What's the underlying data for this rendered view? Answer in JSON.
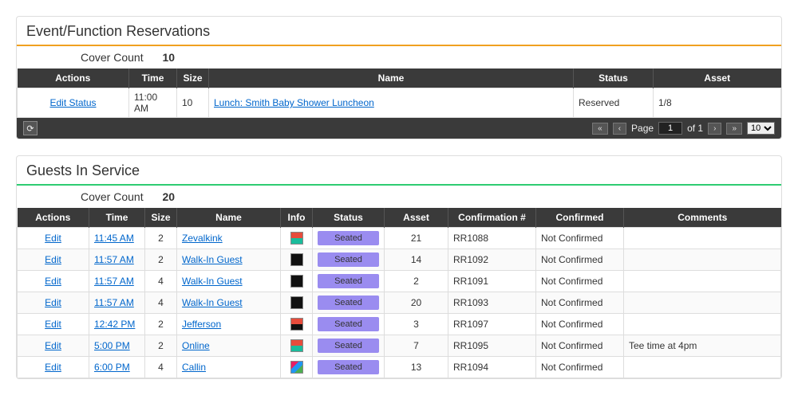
{
  "events": {
    "title": "Event/Function Reservations",
    "cover_label": "Cover Count",
    "cover_value": "10",
    "columns": {
      "actions": "Actions",
      "time": "Time",
      "size": "Size",
      "name": "Name",
      "status": "Status",
      "asset": "Asset"
    },
    "rows": [
      {
        "action_label": "Edit Status",
        "time": "11:00 AM",
        "size": "10",
        "name": "Lunch: Smith Baby Shower Luncheon",
        "status": "Reserved",
        "asset": "1/8"
      }
    ],
    "pager": {
      "page_label_pre": "Page",
      "page_value": "1",
      "page_label_post": "of 1",
      "page_size": "10"
    }
  },
  "guests": {
    "title": "Guests In Service",
    "cover_label": "Cover Count",
    "cover_value": "20",
    "columns": {
      "actions": "Actions",
      "time": "Time",
      "size": "Size",
      "name": "Name",
      "info": "Info",
      "status": "Status",
      "asset": "Asset",
      "confirmation": "Confirmation #",
      "confirmed": "Confirmed",
      "comments": "Comments"
    },
    "rows": [
      {
        "action": "Edit",
        "time": "11:45 AM",
        "size": "2",
        "name": "Zevalkink",
        "info_variant": "a",
        "status": "Seated",
        "asset": "21",
        "confirmation": "RR1088",
        "confirmed": "Not Confirmed",
        "comments": ""
      },
      {
        "action": "Edit",
        "time": "11:57 AM",
        "size": "2",
        "name": "Walk-In Guest",
        "info_variant": "b",
        "status": "Seated",
        "asset": "14",
        "confirmation": "RR1092",
        "confirmed": "Not Confirmed",
        "comments": ""
      },
      {
        "action": "Edit",
        "time": "11:57 AM",
        "size": "4",
        "name": "Walk-In Guest",
        "info_variant": "b",
        "status": "Seated",
        "asset": "2",
        "confirmation": "RR1091",
        "confirmed": "Not Confirmed",
        "comments": ""
      },
      {
        "action": "Edit",
        "time": "11:57 AM",
        "size": "4",
        "name": "Walk-In Guest",
        "info_variant": "b",
        "status": "Seated",
        "asset": "20",
        "confirmation": "RR1093",
        "confirmed": "Not Confirmed",
        "comments": ""
      },
      {
        "action": "Edit",
        "time": "12:42 PM",
        "size": "2",
        "name": "Jefferson",
        "info_variant": "c",
        "status": "Seated",
        "asset": "3",
        "confirmation": "RR1097",
        "confirmed": "Not Confirmed",
        "comments": ""
      },
      {
        "action": "Edit",
        "time": "5:00 PM",
        "size": "2",
        "name": "Online",
        "info_variant": "a",
        "status": "Seated",
        "asset": "7",
        "confirmation": "RR1095",
        "confirmed": "Not Confirmed",
        "comments": "Tee time at 4pm"
      },
      {
        "action": "Edit",
        "time": "6:00 PM",
        "size": "4",
        "name": "Callin",
        "info_variant": "d",
        "status": "Seated",
        "asset": "13",
        "confirmation": "RR1094",
        "confirmed": "Not Confirmed",
        "comments": ""
      }
    ]
  }
}
